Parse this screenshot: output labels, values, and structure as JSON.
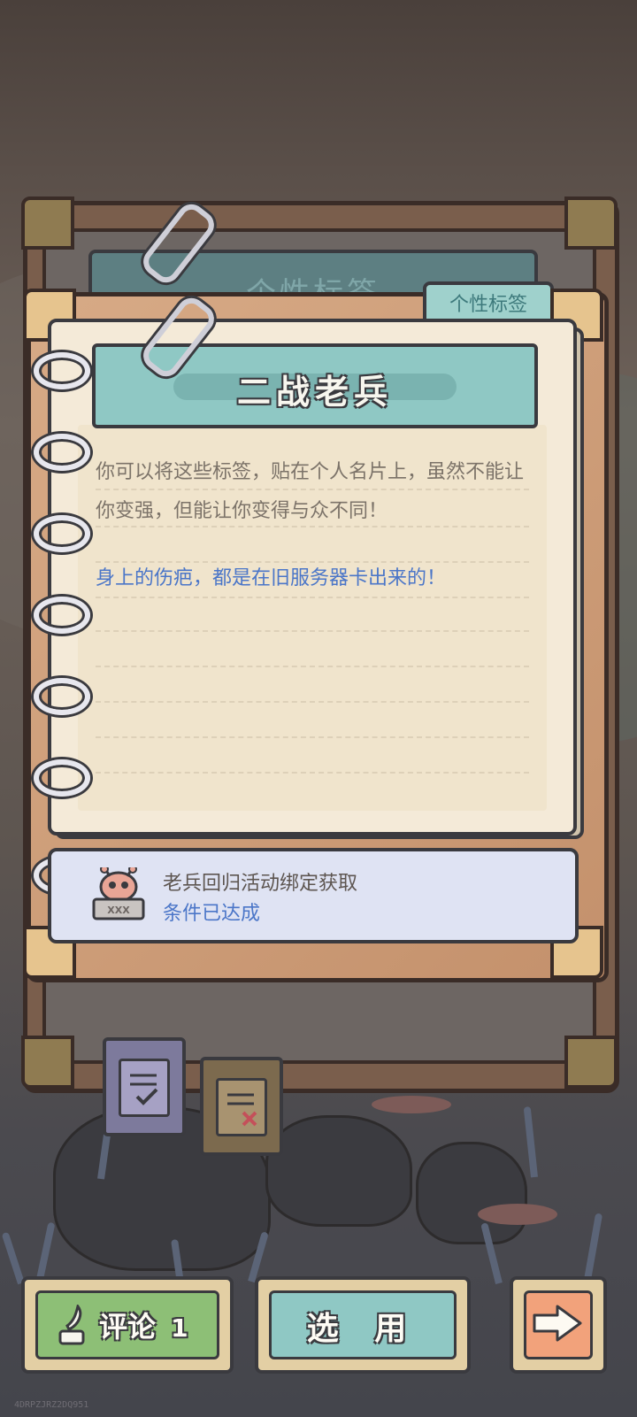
{
  "back_folder": {
    "banner_title": "个性标签"
  },
  "front_folder": {
    "tab_label": "个性标签",
    "tag_name": "二战老兵",
    "description": "你可以将这些标签，贴在个人名片上，虽然不能让你变强，但能让你变得与众不同！",
    "flavor_text": "身上的伤疤，都是在旧服务器卡出来的！",
    "condition": {
      "title": "老兵回归活动绑定获取",
      "status": "条件已达成",
      "icon": "snail-mascot-icon",
      "plate_text": "XXX"
    }
  },
  "side_tabs": [
    {
      "icon": "checklist-icon"
    },
    {
      "icon": "remove-note-icon"
    }
  ],
  "buttons": {
    "comment": {
      "label": "评论",
      "count": "1",
      "icon": "quill-pen-icon"
    },
    "select": {
      "label": "选 用"
    },
    "next": {
      "icon": "right-arrow-icon"
    }
  },
  "footer_id": "4DRPZJRZ2DQ951",
  "colors": {
    "teal_banner": "#8fc8c4",
    "paper": "#f4ead8",
    "link_blue": "#4b76c8",
    "green_button": "#8dbf76",
    "orange_button": "#f2a27b"
  }
}
